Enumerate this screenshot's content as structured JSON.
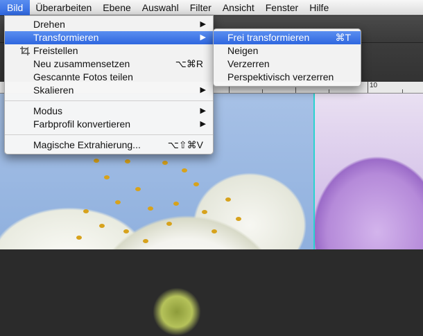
{
  "menubar": {
    "items": [
      "Bild",
      "Überarbeiten",
      "Ebene",
      "Auswahl",
      "Filter",
      "Ansicht",
      "Fenster",
      "Hilfe"
    ]
  },
  "bild_menu": {
    "items": [
      {
        "label": "Drehen"
      },
      {
        "label": "Transformieren"
      },
      {
        "label": "Freistellen",
        "icon": "crop-icon"
      },
      {
        "label": "Neu zusammensetzen",
        "shortcut": "⌥⌘R"
      },
      {
        "label": "Gescannte Fotos teilen"
      },
      {
        "label": "Skalieren"
      },
      {
        "label": "Modus"
      },
      {
        "label": "Farbprofil konvertieren"
      },
      {
        "label": "Magische Extrahierung...",
        "shortcut": "⌥⇧⌘V"
      }
    ]
  },
  "transform_submenu": {
    "items": [
      {
        "label": "Frei transformieren",
        "shortcut": "⌘T"
      },
      {
        "label": "Neigen"
      },
      {
        "label": "Verzerren"
      },
      {
        "label": "Perspektivisch verzerren"
      }
    ]
  },
  "ruler": {
    "label": "10"
  },
  "colors": {
    "highlight": "#3a74e6",
    "guide": "#29d3d0",
    "menubar": "#e6e6e6"
  }
}
